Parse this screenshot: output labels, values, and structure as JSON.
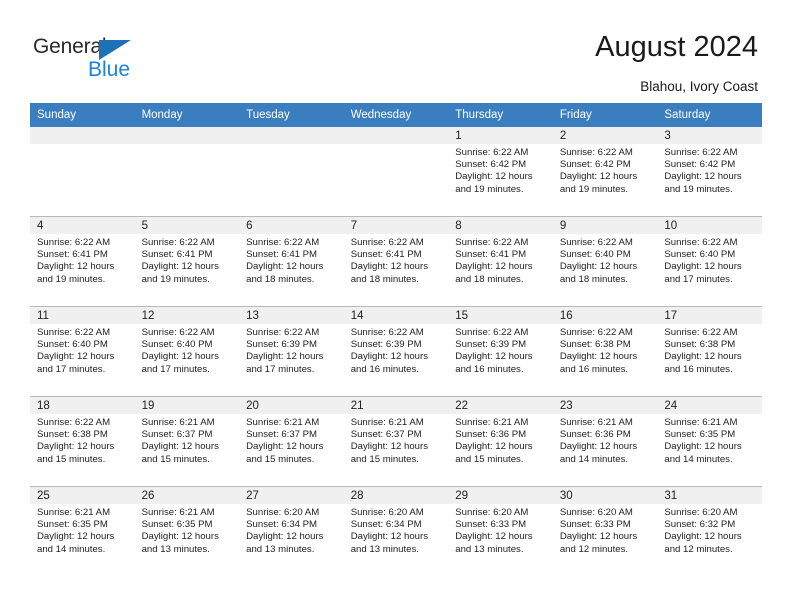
{
  "brand": {
    "name_part1": "General",
    "name_part2": "Blue",
    "triangle_color": "#1c71b8",
    "blue_color": "#1c84d6"
  },
  "header": {
    "title": "August 2024",
    "location": "Blahou, Ivory Coast"
  },
  "theme": {
    "header_row_bg": "#3b7ebf",
    "daynum_bg": "#f0f0f0",
    "grid_line": "#b9b9b9",
    "text": "#222222"
  },
  "weekdays": [
    "Sunday",
    "Monday",
    "Tuesday",
    "Wednesday",
    "Thursday",
    "Friday",
    "Saturday"
  ],
  "weeks": [
    [
      {
        "day": "",
        "sunrise": "",
        "sunset": "",
        "daylight_line1": "",
        "daylight_line2": ""
      },
      {
        "day": "",
        "sunrise": "",
        "sunset": "",
        "daylight_line1": "",
        "daylight_line2": ""
      },
      {
        "day": "",
        "sunrise": "",
        "sunset": "",
        "daylight_line1": "",
        "daylight_line2": ""
      },
      {
        "day": "",
        "sunrise": "",
        "sunset": "",
        "daylight_line1": "",
        "daylight_line2": ""
      },
      {
        "day": "1",
        "sunrise": "Sunrise: 6:22 AM",
        "sunset": "Sunset: 6:42 PM",
        "daylight_line1": "Daylight: 12 hours",
        "daylight_line2": "and 19 minutes."
      },
      {
        "day": "2",
        "sunrise": "Sunrise: 6:22 AM",
        "sunset": "Sunset: 6:42 PM",
        "daylight_line1": "Daylight: 12 hours",
        "daylight_line2": "and 19 minutes."
      },
      {
        "day": "3",
        "sunrise": "Sunrise: 6:22 AM",
        "sunset": "Sunset: 6:42 PM",
        "daylight_line1": "Daylight: 12 hours",
        "daylight_line2": "and 19 minutes."
      }
    ],
    [
      {
        "day": "4",
        "sunrise": "Sunrise: 6:22 AM",
        "sunset": "Sunset: 6:41 PM",
        "daylight_line1": "Daylight: 12 hours",
        "daylight_line2": "and 19 minutes."
      },
      {
        "day": "5",
        "sunrise": "Sunrise: 6:22 AM",
        "sunset": "Sunset: 6:41 PM",
        "daylight_line1": "Daylight: 12 hours",
        "daylight_line2": "and 19 minutes."
      },
      {
        "day": "6",
        "sunrise": "Sunrise: 6:22 AM",
        "sunset": "Sunset: 6:41 PM",
        "daylight_line1": "Daylight: 12 hours",
        "daylight_line2": "and 18 minutes."
      },
      {
        "day": "7",
        "sunrise": "Sunrise: 6:22 AM",
        "sunset": "Sunset: 6:41 PM",
        "daylight_line1": "Daylight: 12 hours",
        "daylight_line2": "and 18 minutes."
      },
      {
        "day": "8",
        "sunrise": "Sunrise: 6:22 AM",
        "sunset": "Sunset: 6:41 PM",
        "daylight_line1": "Daylight: 12 hours",
        "daylight_line2": "and 18 minutes."
      },
      {
        "day": "9",
        "sunrise": "Sunrise: 6:22 AM",
        "sunset": "Sunset: 6:40 PM",
        "daylight_line1": "Daylight: 12 hours",
        "daylight_line2": "and 18 minutes."
      },
      {
        "day": "10",
        "sunrise": "Sunrise: 6:22 AM",
        "sunset": "Sunset: 6:40 PM",
        "daylight_line1": "Daylight: 12 hours",
        "daylight_line2": "and 17 minutes."
      }
    ],
    [
      {
        "day": "11",
        "sunrise": "Sunrise: 6:22 AM",
        "sunset": "Sunset: 6:40 PM",
        "daylight_line1": "Daylight: 12 hours",
        "daylight_line2": "and 17 minutes."
      },
      {
        "day": "12",
        "sunrise": "Sunrise: 6:22 AM",
        "sunset": "Sunset: 6:40 PM",
        "daylight_line1": "Daylight: 12 hours",
        "daylight_line2": "and 17 minutes."
      },
      {
        "day": "13",
        "sunrise": "Sunrise: 6:22 AM",
        "sunset": "Sunset: 6:39 PM",
        "daylight_line1": "Daylight: 12 hours",
        "daylight_line2": "and 17 minutes."
      },
      {
        "day": "14",
        "sunrise": "Sunrise: 6:22 AM",
        "sunset": "Sunset: 6:39 PM",
        "daylight_line1": "Daylight: 12 hours",
        "daylight_line2": "and 16 minutes."
      },
      {
        "day": "15",
        "sunrise": "Sunrise: 6:22 AM",
        "sunset": "Sunset: 6:39 PM",
        "daylight_line1": "Daylight: 12 hours",
        "daylight_line2": "and 16 minutes."
      },
      {
        "day": "16",
        "sunrise": "Sunrise: 6:22 AM",
        "sunset": "Sunset: 6:38 PM",
        "daylight_line1": "Daylight: 12 hours",
        "daylight_line2": "and 16 minutes."
      },
      {
        "day": "17",
        "sunrise": "Sunrise: 6:22 AM",
        "sunset": "Sunset: 6:38 PM",
        "daylight_line1": "Daylight: 12 hours",
        "daylight_line2": "and 16 minutes."
      }
    ],
    [
      {
        "day": "18",
        "sunrise": "Sunrise: 6:22 AM",
        "sunset": "Sunset: 6:38 PM",
        "daylight_line1": "Daylight: 12 hours",
        "daylight_line2": "and 15 minutes."
      },
      {
        "day": "19",
        "sunrise": "Sunrise: 6:21 AM",
        "sunset": "Sunset: 6:37 PM",
        "daylight_line1": "Daylight: 12 hours",
        "daylight_line2": "and 15 minutes."
      },
      {
        "day": "20",
        "sunrise": "Sunrise: 6:21 AM",
        "sunset": "Sunset: 6:37 PM",
        "daylight_line1": "Daylight: 12 hours",
        "daylight_line2": "and 15 minutes."
      },
      {
        "day": "21",
        "sunrise": "Sunrise: 6:21 AM",
        "sunset": "Sunset: 6:37 PM",
        "daylight_line1": "Daylight: 12 hours",
        "daylight_line2": "and 15 minutes."
      },
      {
        "day": "22",
        "sunrise": "Sunrise: 6:21 AM",
        "sunset": "Sunset: 6:36 PM",
        "daylight_line1": "Daylight: 12 hours",
        "daylight_line2": "and 15 minutes."
      },
      {
        "day": "23",
        "sunrise": "Sunrise: 6:21 AM",
        "sunset": "Sunset: 6:36 PM",
        "daylight_line1": "Daylight: 12 hours",
        "daylight_line2": "and 14 minutes."
      },
      {
        "day": "24",
        "sunrise": "Sunrise: 6:21 AM",
        "sunset": "Sunset: 6:35 PM",
        "daylight_line1": "Daylight: 12 hours",
        "daylight_line2": "and 14 minutes."
      }
    ],
    [
      {
        "day": "25",
        "sunrise": "Sunrise: 6:21 AM",
        "sunset": "Sunset: 6:35 PM",
        "daylight_line1": "Daylight: 12 hours",
        "daylight_line2": "and 14 minutes."
      },
      {
        "day": "26",
        "sunrise": "Sunrise: 6:21 AM",
        "sunset": "Sunset: 6:35 PM",
        "daylight_line1": "Daylight: 12 hours",
        "daylight_line2": "and 13 minutes."
      },
      {
        "day": "27",
        "sunrise": "Sunrise: 6:20 AM",
        "sunset": "Sunset: 6:34 PM",
        "daylight_line1": "Daylight: 12 hours",
        "daylight_line2": "and 13 minutes."
      },
      {
        "day": "28",
        "sunrise": "Sunrise: 6:20 AM",
        "sunset": "Sunset: 6:34 PM",
        "daylight_line1": "Daylight: 12 hours",
        "daylight_line2": "and 13 minutes."
      },
      {
        "day": "29",
        "sunrise": "Sunrise: 6:20 AM",
        "sunset": "Sunset: 6:33 PM",
        "daylight_line1": "Daylight: 12 hours",
        "daylight_line2": "and 13 minutes."
      },
      {
        "day": "30",
        "sunrise": "Sunrise: 6:20 AM",
        "sunset": "Sunset: 6:33 PM",
        "daylight_line1": "Daylight: 12 hours",
        "daylight_line2": "and 12 minutes."
      },
      {
        "day": "31",
        "sunrise": "Sunrise: 6:20 AM",
        "sunset": "Sunset: 6:32 PM",
        "daylight_line1": "Daylight: 12 hours",
        "daylight_line2": "and 12 minutes."
      }
    ]
  ]
}
